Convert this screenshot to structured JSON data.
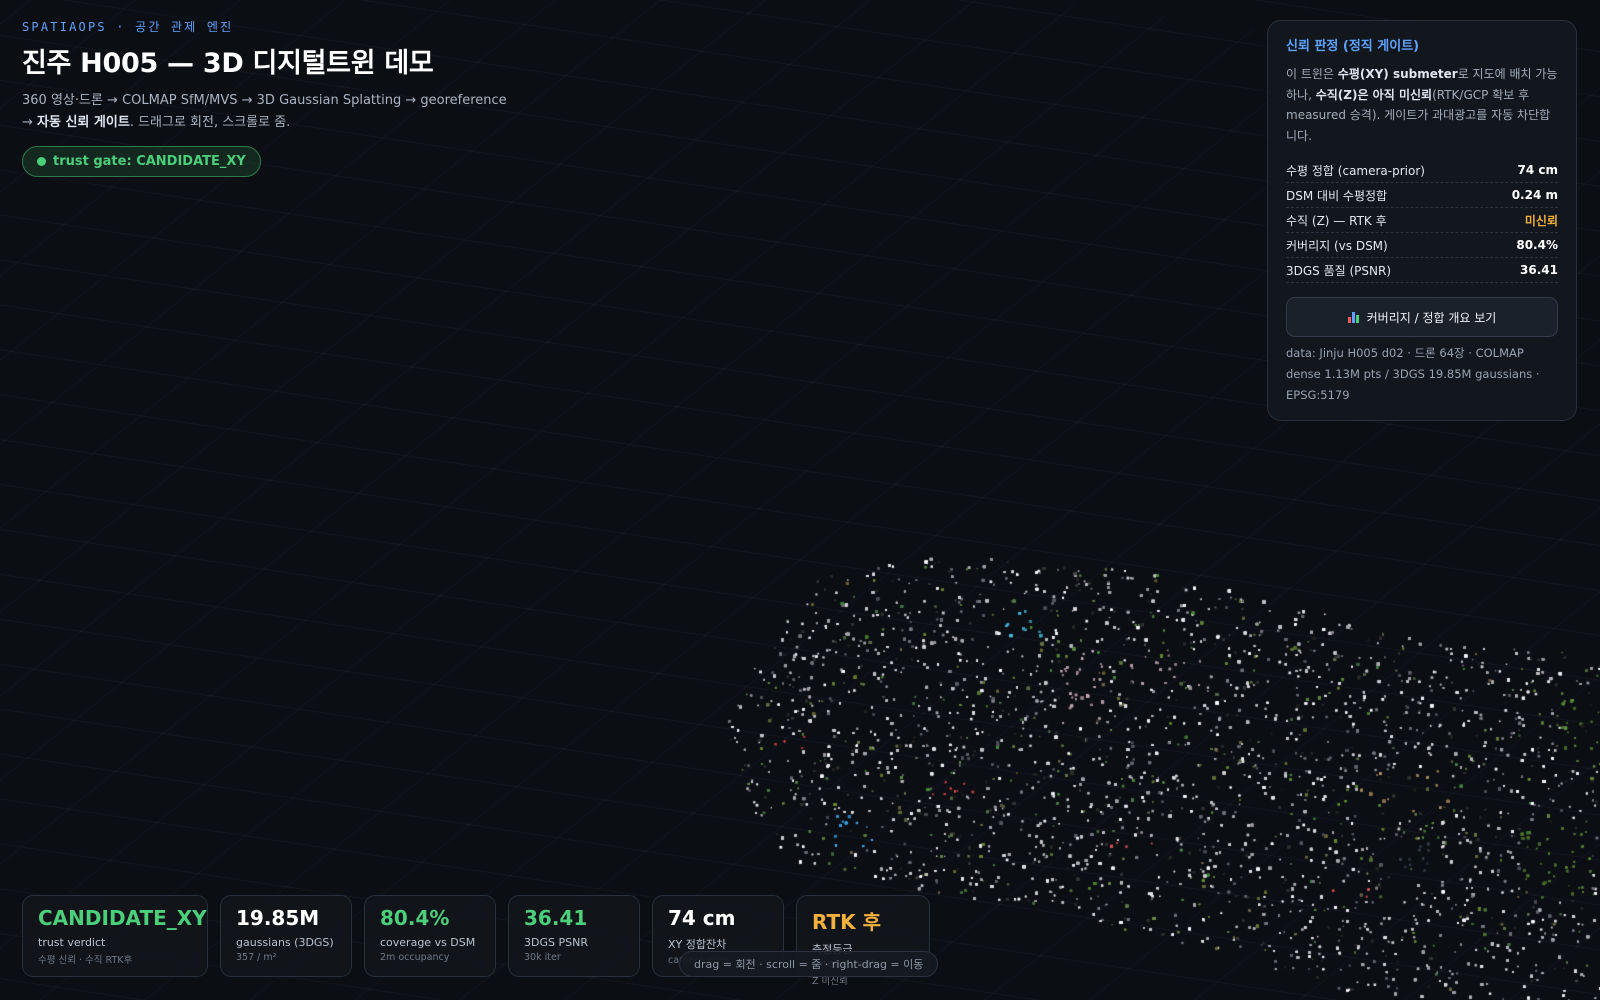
{
  "header": {
    "brand": "SPATIAOPS · 공간 관제 엔진",
    "title": "진주 H005 — 3D 디지털트윈 데모",
    "desc_line1": "360 영상·드론 → COLMAP SfM/MVS → 3D Gaussian Splatting → georeference",
    "desc_line2_prefix": "→ ",
    "desc_line2_bold": "자동 신뢰 게이트",
    "desc_line2_suffix": ". 드래그로 회전, 스크롤로 줌.",
    "trust_pill": "trust gate: CANDIDATE_XY"
  },
  "panel": {
    "title": "신뢰 판정 (정직 게이트)",
    "desc": {
      "p1": "이 트윈은 ",
      "b1": "수평(XY) submeter",
      "p2": "로 지도에 배치 가능하나, ",
      "b2": "수직(Z)은 아직 미신뢰",
      "p3": "(RTK/GCP 확보 후 measured 승격). 게이트가 과대광고를 자동 차단합니다."
    },
    "metrics": [
      {
        "label": "수평 정합 (camera-prior)",
        "value": "74 cm"
      },
      {
        "label": "DSM 대비 수평정합",
        "value": "0.24 m"
      },
      {
        "label": "수직 (Z) — RTK 후",
        "value": "미신뢰"
      },
      {
        "label": "커버리지 (vs DSM)",
        "value": "80.4%"
      },
      {
        "label": "3DGS 품질 (PSNR)",
        "value": "36.41"
      }
    ],
    "button_label": "커버리지 / 정합 개요 보기",
    "data_note": "data: Jinju H005 d02 · 드론 64장 · COLMAP dense 1.13M pts / 3DGS 19.85M gaussians · EPSG:5179"
  },
  "cards": [
    {
      "value": "CANDIDATE_XY",
      "label": "trust verdict",
      "sub": "수평 신뢰 · 수직 RTK후"
    },
    {
      "value": "19.85M",
      "label": "gaussians (3DGS)",
      "sub": "357 / m²"
    },
    {
      "value": "80.4%",
      "label": "coverage vs DSM",
      "sub": "2m occupancy"
    },
    {
      "value": "36.41",
      "label": "3DGS PSNR",
      "sub": "30k iter"
    },
    {
      "value": "74 cm",
      "label": "XY 정합잔차",
      "sub": "camera-prior"
    },
    {
      "value": "RTK 후",
      "label": "측정등급 (measured)",
      "sub": "Z 미신뢰"
    }
  ],
  "hint": "drag = 회전 · scroll = 줌 · right-drag = 이동",
  "colors": {
    "accent": "#5ea2ff",
    "good": "#4ccf7a",
    "warn": "#f2b13c",
    "background": "#0b0e13"
  },
  "icons": {
    "trust_dot": "status-dot-icon",
    "overview_button": "bar-chart-icon"
  }
}
